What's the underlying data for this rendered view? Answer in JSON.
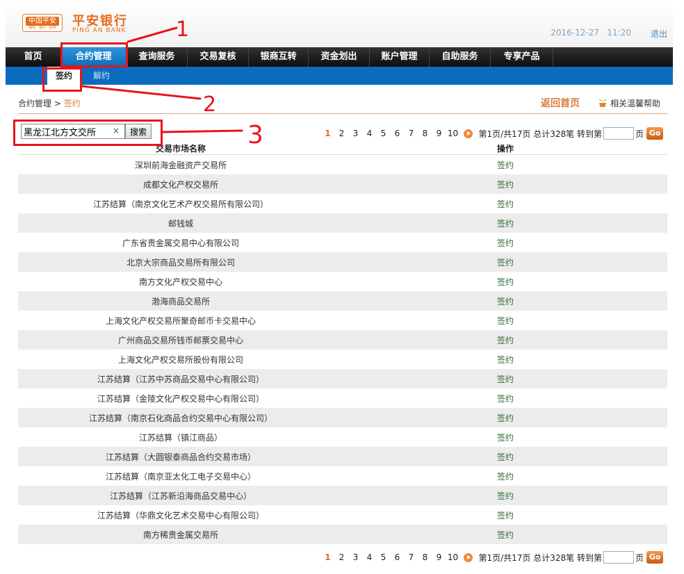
{
  "header": {
    "logo_mark_top": "中国平安",
    "logo_mark_bottom": "保险 · 银行 · 投资",
    "bank_name": "平安银行",
    "bank_en": "PING AN BANK",
    "date": "2016-12-27",
    "time": "11:20",
    "logout": "退出"
  },
  "nav": {
    "items": [
      "首页",
      "合约管理",
      "查询服务",
      "交易复核",
      "银商互转",
      "资金划出",
      "账户管理",
      "自助服务",
      "专享产品"
    ],
    "active_index": 1
  },
  "subnav": {
    "items": [
      "签约",
      "解约"
    ],
    "active_index": 0
  },
  "breadcrumb": {
    "root": "合约管理",
    "sep": ">",
    "current": "签约",
    "back_home": "返回首页",
    "help": "相关温馨帮助"
  },
  "search": {
    "value": "黑龙江北方文交所",
    "clear": "×",
    "button": "搜索"
  },
  "pager": {
    "pages": [
      "1",
      "2",
      "3",
      "4",
      "5",
      "6",
      "7",
      "8",
      "9",
      "10"
    ],
    "current": "1",
    "info": "第1页/共17页 总计328笔",
    "goto_prefix": "转到第",
    "goto_suffix": "页",
    "go": "Go"
  },
  "table": {
    "headers": [
      "交易市场名称",
      "操作"
    ],
    "action_label": "签约",
    "rows": [
      "深圳前海金融资产交易所",
      "成都文化产权交易所",
      "江苏结算（南京文化艺术产权交易所有限公司）",
      "邮钱城",
      "广东省贵金属交易中心有限公司",
      "北京大宗商品交易所有限公司",
      "南方文化产权交易中心",
      "渤海商品交易所",
      "上海文化产权交易所聚奇邮币卡交易中心",
      "广州商品交易所钱币邮票交易中心",
      "上海文化产权交易所股份有限公司",
      "江苏结算（江苏中苏商品交易中心有限公司）",
      "江苏结算（金陵文化产权交易中心有限公司）",
      "江苏结算（南京石化商品合约交易中心有限公司）",
      "江苏结算（镇江商品）",
      "江苏结算（大圆银泰商品合约交易市场）",
      "江苏结算（南京亚太化工电子交易中心）",
      "江苏结算（江苏新沿海商品交易中心）",
      "江苏结算（华鼎文化艺术交易中心有限公司）",
      "南方稀贵金属交易所"
    ]
  },
  "annotations": {
    "labels": [
      "1",
      "2",
      "3"
    ],
    "color": "#e8141b"
  },
  "colors": {
    "brand_orange": "#e56b1a",
    "nav_active_blue": "#1e82cf",
    "subnav_blue": "#0b6cbf",
    "link_green": "#2f6b3a"
  }
}
